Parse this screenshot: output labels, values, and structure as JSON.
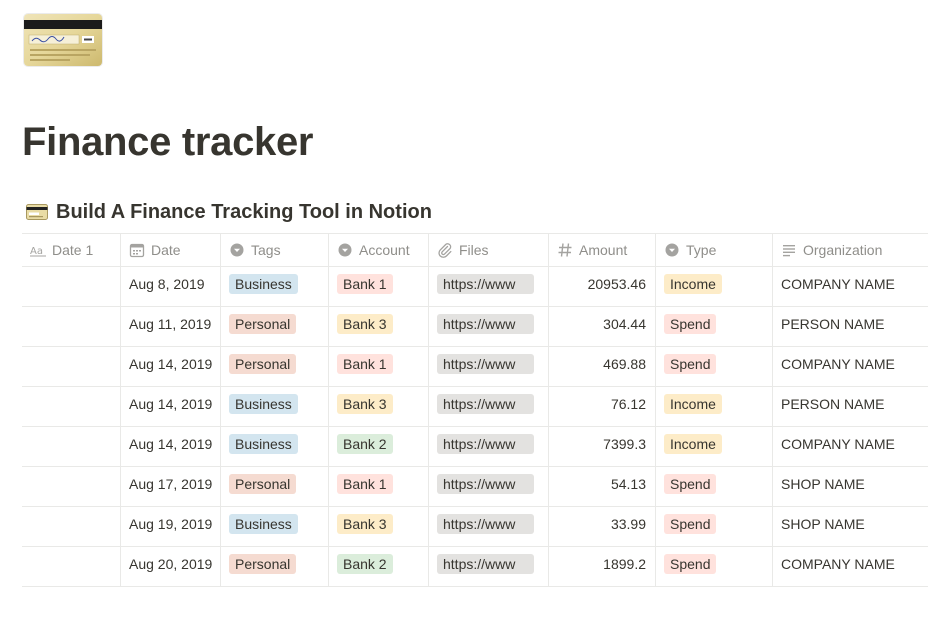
{
  "page": {
    "title": "Finance tracker"
  },
  "database": {
    "title": "Build A Finance Tracking Tool in Notion",
    "title_icon": "credit-card-icon",
    "columns": [
      {
        "key": "date1",
        "label": "Date 1",
        "icon": "text-aa-icon"
      },
      {
        "key": "date",
        "label": "Date",
        "icon": "calendar-icon"
      },
      {
        "key": "tags",
        "label": "Tags",
        "icon": "select-chevron-icon"
      },
      {
        "key": "account",
        "label": "Account",
        "icon": "select-chevron-icon"
      },
      {
        "key": "files",
        "label": "Files",
        "icon": "paperclip-icon"
      },
      {
        "key": "amount",
        "label": "Amount",
        "icon": "hash-icon"
      },
      {
        "key": "type",
        "label": "Type",
        "icon": "select-chevron-icon"
      },
      {
        "key": "organization",
        "label": "Organization",
        "icon": "text-lines-icon"
      }
    ],
    "rows": [
      {
        "date1": "",
        "date": "Aug 8, 2019",
        "tags": "Business",
        "account": "Bank 1",
        "files": "https://www",
        "amount": "20953.46",
        "type": "Income",
        "organization": "COMPANY NAME"
      },
      {
        "date1": "",
        "date": "Aug 11, 2019",
        "tags": "Personal",
        "account": "Bank 3",
        "files": "https://www",
        "amount": "304.44",
        "type": "Spend",
        "organization": "PERSON NAME"
      },
      {
        "date1": "",
        "date": "Aug 14, 2019",
        "tags": "Personal",
        "account": "Bank 1",
        "files": "https://www",
        "amount": "469.88",
        "type": "Spend",
        "organization": "COMPANY NAME"
      },
      {
        "date1": "",
        "date": "Aug 14, 2019",
        "tags": "Business",
        "account": "Bank 3",
        "files": "https://www",
        "amount": "76.12",
        "type": "Income",
        "organization": "PERSON NAME"
      },
      {
        "date1": "",
        "date": "Aug 14, 2019",
        "tags": "Business",
        "account": "Bank 2",
        "files": "https://www",
        "amount": "7399.3",
        "type": "Income",
        "organization": "COMPANY NAME"
      },
      {
        "date1": "",
        "date": "Aug 17, 2019",
        "tags": "Personal",
        "account": "Bank 1",
        "files": "https://www",
        "amount": "54.13",
        "type": "Spend",
        "organization": "SHOP NAME"
      },
      {
        "date1": "",
        "date": "Aug 19, 2019",
        "tags": "Business",
        "account": "Bank 3",
        "files": "https://www",
        "amount": "33.99",
        "type": "Spend",
        "organization": "SHOP NAME"
      },
      {
        "date1": "",
        "date": "Aug 20, 2019",
        "tags": "Personal",
        "account": "Bank 2",
        "files": "https://www",
        "amount": "1899.2",
        "type": "Spend",
        "organization": "COMPANY NAME"
      }
    ]
  },
  "colors": {
    "Business": "#d3e5ef",
    "Personal": "#f5dbd1",
    "Bank 1": "#ffe2dd",
    "Bank 2": "#dbeddb",
    "Bank 3": "#fdecc8",
    "Income": "#fdecc8",
    "Spend": "#ffe2dd"
  }
}
